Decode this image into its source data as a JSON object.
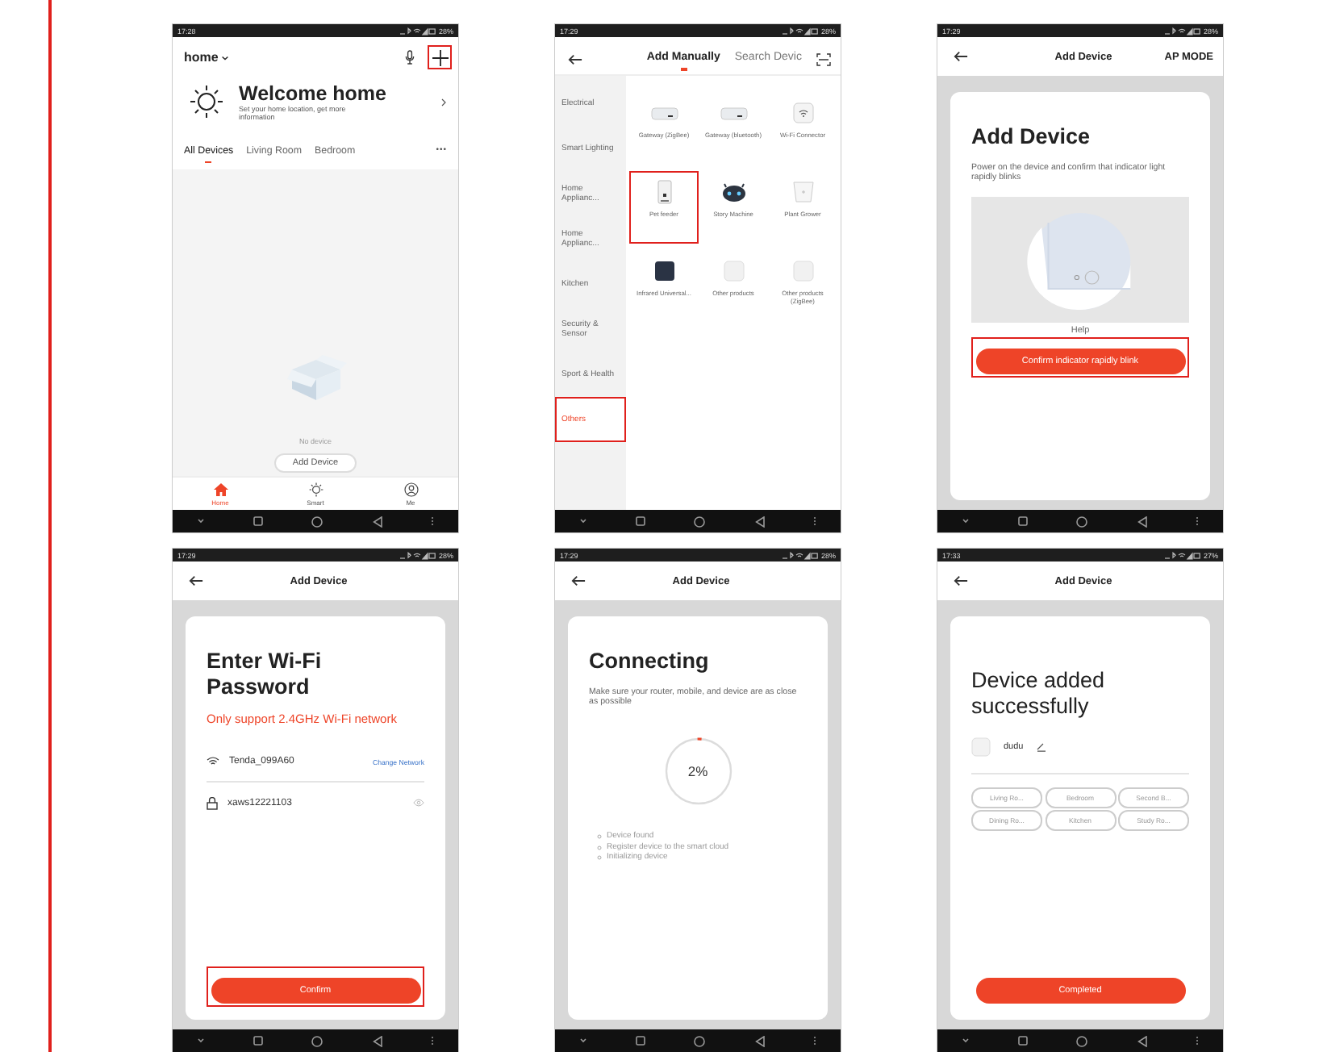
{
  "screens": [
    {
      "kind": "home",
      "status": {
        "time": "17:28",
        "battery": "28%"
      },
      "home_selector": "home",
      "add_highlighted": true,
      "welcome": {
        "title": "Welcome home",
        "subtitle": "Set your home location, get more information"
      },
      "tabs": [
        {
          "label": "All Devices",
          "selected": true
        },
        {
          "label": "Living Room",
          "selected": false
        },
        {
          "label": "Bedroom",
          "selected": false
        }
      ],
      "more": "•••",
      "empty_text": "No device",
      "add_button": "Add Device",
      "bottom_tabs": [
        {
          "label": "Home",
          "selected": true
        },
        {
          "label": "Smart",
          "selected": false
        },
        {
          "label": "Me",
          "selected": false
        }
      ]
    },
    {
      "kind": "categories",
      "status": {
        "time": "17:29",
        "battery": "28%"
      },
      "tabs": [
        {
          "label": "Add Manually",
          "selected": true
        },
        {
          "label": "Search Devic",
          "selected": false
        }
      ],
      "categories": [
        {
          "label": "Electrical",
          "selected": false,
          "highlighted": false
        },
        {
          "label": "Smart Lighting",
          "selected": false,
          "highlighted": false
        },
        {
          "label": "Home Applianc...",
          "selected": false,
          "highlighted": false
        },
        {
          "label": "Home Applianc...",
          "selected": false,
          "highlighted": false
        },
        {
          "label": "Kitchen",
          "selected": false,
          "highlighted": false
        },
        {
          "label": "Security & Sensor",
          "selected": false,
          "highlighted": false
        },
        {
          "label": "Sport & Health",
          "selected": false,
          "highlighted": false
        },
        {
          "label": "Others",
          "selected": true,
          "highlighted": true
        }
      ],
      "products": [
        {
          "label": "Gateway (ZigBee)",
          "highlighted": false
        },
        {
          "label": "Gateway (bluetooth)",
          "highlighted": false
        },
        {
          "label": "Wi-Fi Connector",
          "highlighted": false
        },
        {
          "label": "Pet feeder",
          "highlighted": true
        },
        {
          "label": "Story Machine",
          "highlighted": false
        },
        {
          "label": "Plant Grower",
          "highlighted": false
        },
        {
          "label": "Infrared Universal...",
          "highlighted": false
        },
        {
          "label": "Other products",
          "highlighted": false
        },
        {
          "label": "Other products (ZigBee)",
          "highlighted": false
        }
      ]
    },
    {
      "kind": "ap_mode",
      "status": {
        "time": "17:29",
        "battery": "28%"
      },
      "title": "Add Device",
      "action": "AP MODE",
      "heading": "Add Device",
      "description": "Power on the device and confirm that indicator light rapidly blinks",
      "help": "Help",
      "button": {
        "label": "Confirm indicator rapidly blink",
        "highlighted": true
      }
    },
    {
      "kind": "wifi",
      "status": {
        "time": "17:29",
        "battery": "28%"
      },
      "title": "Add Device",
      "heading": "Enter Wi-Fi Password",
      "warning": "Only support 2.4GHz Wi-Fi network",
      "network": "Tenda_099A60",
      "change_link": "Change Network",
      "password": "xaws12221103",
      "button": {
        "label": "Confirm",
        "highlighted": true
      }
    },
    {
      "kind": "connecting",
      "status": {
        "time": "17:29",
        "battery": "28%"
      },
      "title": "Add Device",
      "heading": "Connecting",
      "description": "Make sure your router, mobile, and device are as close as possible",
      "progress_text": "2%",
      "level": 0.02,
      "steps": [
        "Device found",
        "Register device to the smart cloud",
        "Initializing device"
      ]
    },
    {
      "kind": "success",
      "status": {
        "time": "17:33",
        "battery": "27%"
      },
      "title": "Add Device",
      "heading": "Device added successfully",
      "device_name": "dudu",
      "rooms": [
        "Living Ro...",
        "Bedroom",
        "Second B...",
        "Dining Ro...",
        "Kitchen",
        "Study Ro..."
      ],
      "button": {
        "label": "Completed",
        "highlighted": false
      }
    }
  ]
}
